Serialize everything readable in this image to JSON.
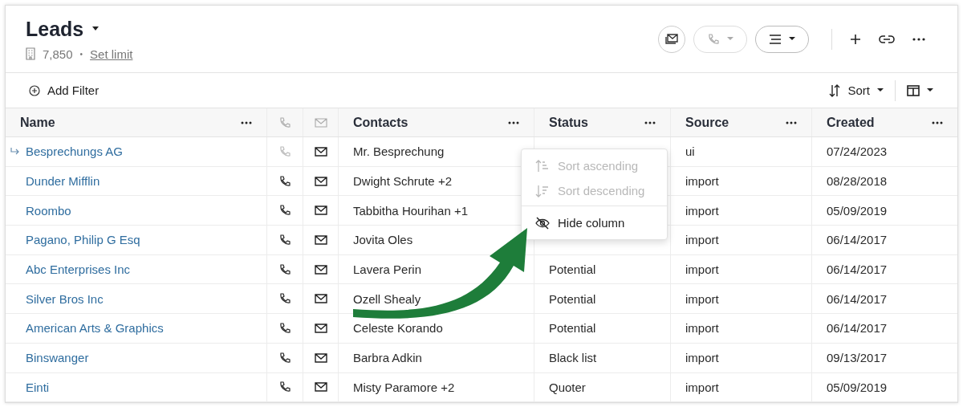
{
  "header": {
    "title": "Leads",
    "count": "7,850",
    "separator": "•",
    "limit_link": "Set limit"
  },
  "toolbar": {
    "phone_disabled": true
  },
  "filter_bar": {
    "add_filter": "Add Filter",
    "sort": "Sort"
  },
  "table": {
    "columns": [
      {
        "kind": "text",
        "label": "Name"
      },
      {
        "kind": "phone"
      },
      {
        "kind": "mail"
      },
      {
        "kind": "text",
        "label": "Contacts"
      },
      {
        "kind": "text",
        "label": "Status"
      },
      {
        "kind": "text",
        "label": "Source"
      },
      {
        "kind": "text",
        "label": "Created"
      }
    ],
    "rows": [
      {
        "name": "Besprechungs AG",
        "linked": true,
        "phone_disabled": true,
        "contacts": "Mr. Besprechung",
        "source": "ui",
        "created": "07/24/2023"
      },
      {
        "name": "Dunder Mifflin",
        "linked": false,
        "phone_disabled": false,
        "contacts": "Dwight Schrute +2",
        "source": "import",
        "created": "08/28/2018"
      },
      {
        "name": "Roombo",
        "linked": false,
        "phone_disabled": false,
        "contacts": "Tabbitha Hourihan +1",
        "source": "import",
        "created": "05/09/2019"
      },
      {
        "name": "Pagano, Philip G Esq",
        "linked": false,
        "phone_disabled": false,
        "contacts": "Jovita Oles",
        "source": "import",
        "created": "06/14/2017"
      },
      {
        "name": "Abc Enterprises Inc",
        "linked": false,
        "phone_disabled": false,
        "contacts": "Lavera Perin",
        "status": "Potential",
        "source": "import",
        "created": "06/14/2017"
      },
      {
        "name": "Silver Bros Inc",
        "linked": false,
        "phone_disabled": false,
        "contacts": "Ozell Shealy",
        "status": "Potential",
        "source": "import",
        "created": "06/14/2017"
      },
      {
        "name": "American Arts & Graphics",
        "linked": false,
        "phone_disabled": false,
        "contacts": "Celeste Korando",
        "status": "Potential",
        "source": "import",
        "created": "06/14/2017"
      },
      {
        "name": "Binswanger",
        "linked": false,
        "phone_disabled": false,
        "contacts": "Barbra Adkin",
        "status": "Black list",
        "source": "import",
        "created": "09/13/2017"
      },
      {
        "name": "Einti",
        "linked": false,
        "phone_disabled": false,
        "contacts": "Misty Paramore +2",
        "status": "Quoter",
        "source": "import",
        "created": "05/09/2019"
      }
    ]
  },
  "column_menu": {
    "groups": [
      [
        {
          "kind": "sort-asc",
          "label": "Sort ascending",
          "disabled": true
        },
        {
          "kind": "sort-desc",
          "label": "Sort descending",
          "disabled": true
        }
      ],
      [
        {
          "kind": "hide",
          "label": "Hide column",
          "disabled": false
        }
      ]
    ]
  }
}
